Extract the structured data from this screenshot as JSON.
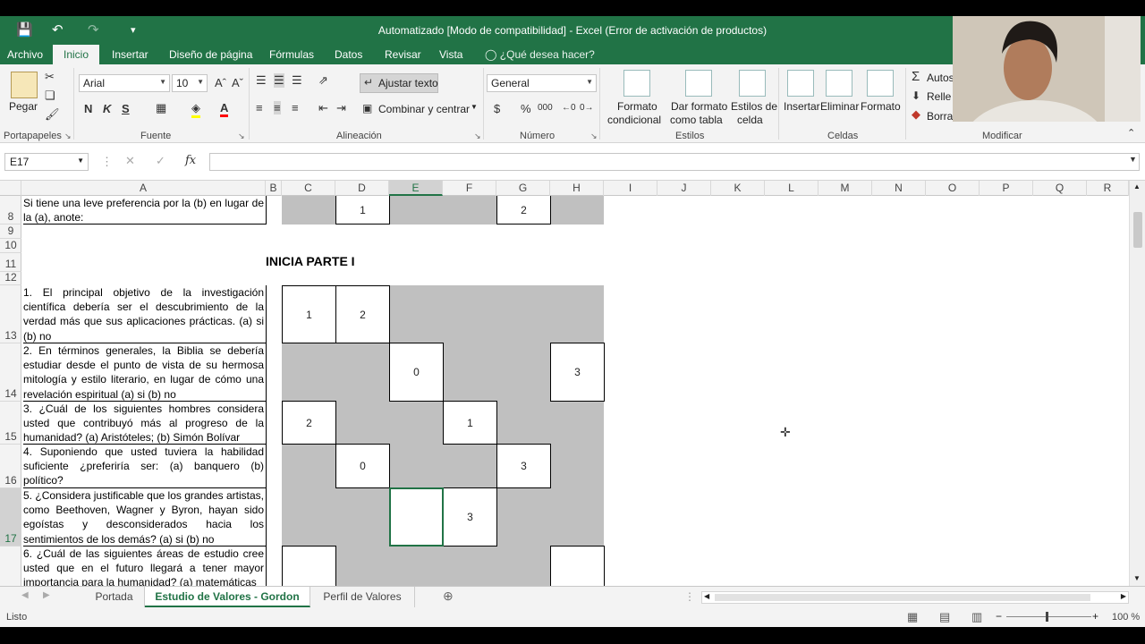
{
  "window": {
    "title": "Automatizado  [Modo de compatibilidad] - Excel (Error de activación de productos)"
  },
  "ribbon_tabs": [
    "Archivo",
    "Inicio",
    "Insertar",
    "Diseño de página",
    "Fórmulas",
    "Datos",
    "Revisar",
    "Vista"
  ],
  "tell_me": "¿Qué desea hacer?",
  "ribbon": {
    "clipboard": {
      "paste": "Pegar",
      "group": "Portapapeles"
    },
    "font": {
      "name": "Arial",
      "size": "10",
      "bold": "N",
      "italic": "K",
      "underline": "S",
      "group": "Fuente"
    },
    "alignment": {
      "wrap": "Ajustar texto",
      "merge": "Combinar y centrar",
      "group": "Alineación"
    },
    "number": {
      "format": "General",
      "currency": "$",
      "percent": "%",
      "thousands": "000",
      "group": "Número"
    },
    "styles": {
      "cond1": "Formato",
      "cond2": "condicional",
      "table1": "Dar formato",
      "table2": "como tabla",
      "cell1": "Estilos de",
      "cell2": "celda",
      "group": "Estilos"
    },
    "cells": {
      "insert": "Insertar",
      "delete": "Eliminar",
      "format": "Formato",
      "group": "Celdas"
    },
    "edit": {
      "autosum": "Autos",
      "fill": "Relle",
      "clear": "Borrar",
      "group": "Modificar"
    }
  },
  "formula": {
    "namebox": "E17",
    "fx": "fx",
    "value": ""
  },
  "columns": [
    "A",
    "B",
    "C",
    "D",
    "E",
    "F",
    "G",
    "H",
    "I",
    "J",
    "K",
    "L",
    "M",
    "N",
    "O",
    "P",
    "Q",
    "R"
  ],
  "rows": [
    "8",
    "9",
    "10",
    "11",
    "12",
    "13",
    "14",
    "15",
    "16",
    "17"
  ],
  "sheet": {
    "row8_text": "Si tiene una leve preferencia por la (b) en lugar de la (a), anote:",
    "heading": "INICIA PARTE I",
    "q1": "1. El principal objetivo de la investigación científica debería ser el descubrimiento de la verdad más que sus aplicaciones prácticas. (a) si (b) no",
    "q2": "2. En términos generales, la Biblia se debería estudiar desde el punto de vista de su hermosa mitología y estilo literario, en lugar de cómo una revelación espiritual (a) si (b) no",
    "q3": "3. ¿Cuál de los siguientes hombres considera usted que contribuyó más al progreso de la humanidad? (a) Aristóteles; (b) Simón Bolívar",
    "q4": "4. Suponiendo que usted tuviera la habilidad suficiente ¿preferiría ser: (a) banquero (b) político?",
    "q5": "5. ¿Considera justificable que los grandes artistas, como Beethoven, Wagner y Byron, hayan sido egoístas y desconsiderados hacia los sentimientos de los demás? (a) si (b) no",
    "q6": "6. ¿Cuál de las siguientes áreas de estudio cree usted que en el futuro llegará a tener mayor importancia para la humanidad? (a) matemáticas",
    "values": {
      "r8_d": "1",
      "r8_g": "2",
      "r13_c": "1",
      "r13_d": "2",
      "r14_e": "0",
      "r14_h": "3",
      "r15_c": "2",
      "r15_f": "1",
      "r16_d": "0",
      "r16_g": "3",
      "r17_f": "3"
    }
  },
  "sheet_tabs": [
    "Portada",
    "Estudio de Valores - Gordon",
    "Perfil de Valores"
  ],
  "status": {
    "ready": "Listo",
    "zoom": "100 %"
  }
}
